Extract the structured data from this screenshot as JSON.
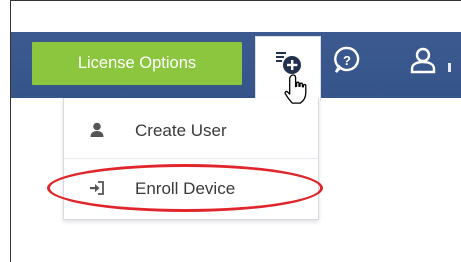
{
  "header": {
    "license_button": "License Options",
    "add_icon": "add-plus-icon",
    "help_icon": "help-question-icon",
    "user_icon": "user-account-icon"
  },
  "dropdown": {
    "items": [
      {
        "label": "Create User",
        "icon": "user-silhouette-icon"
      },
      {
        "label": "Enroll Device",
        "icon": "sign-in-arrow-icon"
      }
    ]
  },
  "colors": {
    "topbar": "#3c5a8f",
    "license_button": "#8cc63f",
    "highlight": "#e0262c"
  }
}
